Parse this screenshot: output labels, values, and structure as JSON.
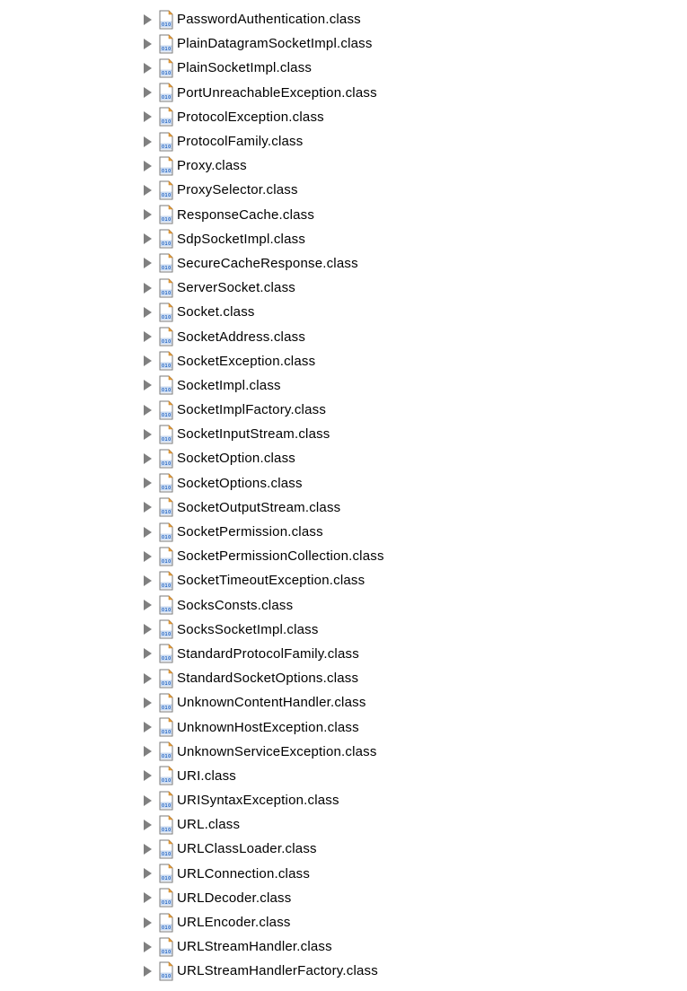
{
  "tree": {
    "items": [
      {
        "label": "PasswordAuthentication.class",
        "icon": "class-file-icon"
      },
      {
        "label": "PlainDatagramSocketImpl.class",
        "icon": "class-file-icon"
      },
      {
        "label": "PlainSocketImpl.class",
        "icon": "class-file-icon"
      },
      {
        "label": "PortUnreachableException.class",
        "icon": "class-file-icon"
      },
      {
        "label": "ProtocolException.class",
        "icon": "class-file-icon"
      },
      {
        "label": "ProtocolFamily.class",
        "icon": "class-file-icon"
      },
      {
        "label": "Proxy.class",
        "icon": "class-file-icon"
      },
      {
        "label": "ProxySelector.class",
        "icon": "class-file-icon"
      },
      {
        "label": "ResponseCache.class",
        "icon": "class-file-icon"
      },
      {
        "label": "SdpSocketImpl.class",
        "icon": "class-file-icon"
      },
      {
        "label": "SecureCacheResponse.class",
        "icon": "class-file-icon"
      },
      {
        "label": "ServerSocket.class",
        "icon": "class-file-icon"
      },
      {
        "label": "Socket.class",
        "icon": "class-file-icon"
      },
      {
        "label": "SocketAddress.class",
        "icon": "class-file-icon"
      },
      {
        "label": "SocketException.class",
        "icon": "class-file-icon"
      },
      {
        "label": "SocketImpl.class",
        "icon": "class-file-icon"
      },
      {
        "label": "SocketImplFactory.class",
        "icon": "class-file-icon"
      },
      {
        "label": "SocketInputStream.class",
        "icon": "class-file-icon"
      },
      {
        "label": "SocketOption.class",
        "icon": "class-file-icon"
      },
      {
        "label": "SocketOptions.class",
        "icon": "class-file-icon"
      },
      {
        "label": "SocketOutputStream.class",
        "icon": "class-file-icon"
      },
      {
        "label": "SocketPermission.class",
        "icon": "class-file-icon"
      },
      {
        "label": "SocketPermissionCollection.class",
        "icon": "class-file-icon"
      },
      {
        "label": "SocketTimeoutException.class",
        "icon": "class-file-icon"
      },
      {
        "label": "SocksConsts.class",
        "icon": "class-file-icon"
      },
      {
        "label": "SocksSocketImpl.class",
        "icon": "class-file-icon"
      },
      {
        "label": "StandardProtocolFamily.class",
        "icon": "class-file-icon"
      },
      {
        "label": "StandardSocketOptions.class",
        "icon": "class-file-icon"
      },
      {
        "label": "UnknownContentHandler.class",
        "icon": "class-file-icon"
      },
      {
        "label": "UnknownHostException.class",
        "icon": "class-file-icon"
      },
      {
        "label": "UnknownServiceException.class",
        "icon": "class-file-icon"
      },
      {
        "label": "URI.class",
        "icon": "class-file-icon"
      },
      {
        "label": "URISyntaxException.class",
        "icon": "class-file-icon"
      },
      {
        "label": "URL.class",
        "icon": "class-file-icon"
      },
      {
        "label": "URLClassLoader.class",
        "icon": "class-file-icon"
      },
      {
        "label": "URLConnection.class",
        "icon": "class-file-icon"
      },
      {
        "label": "URLDecoder.class",
        "icon": "class-file-icon"
      },
      {
        "label": "URLEncoder.class",
        "icon": "class-file-icon"
      },
      {
        "label": "URLStreamHandler.class",
        "icon": "class-file-icon"
      },
      {
        "label": "URLStreamHandlerFactory.class",
        "icon": "class-file-icon"
      }
    ]
  },
  "colors": {
    "disclosure": "#808080",
    "text": "#000000",
    "icon_page": "#ffffff",
    "icon_border": "#7a7a7a",
    "icon_bits": "#1e5fbf",
    "icon_bits_bg": "#d8e6f7",
    "icon_fold": "#e8a33b"
  }
}
